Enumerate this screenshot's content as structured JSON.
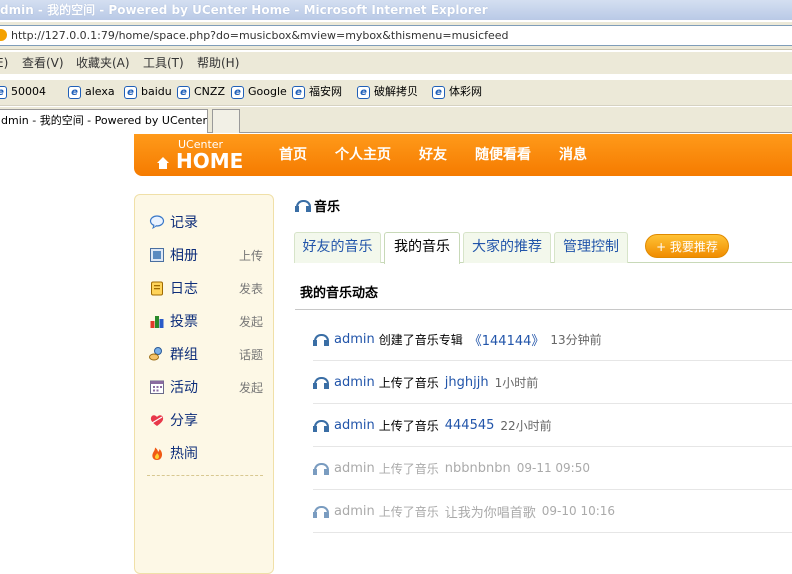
{
  "window": {
    "title": "dmin - 我的空间 - Powered by UCenter Home - Microsoft Internet Explorer"
  },
  "address": {
    "url": "http://127.0.0.1:79/home/space.php?do=musicbox&mview=mybox&thismenu=musicfeed"
  },
  "menu": {
    "items": [
      "E)",
      "查看(V)",
      "收藏夹(A)",
      "工具(T)",
      "帮助(H)"
    ]
  },
  "links": {
    "items": [
      "50004",
      "alexa",
      "baidu",
      "CNZZ",
      "Google",
      "福安网",
      "破解拷贝",
      "体彩网"
    ]
  },
  "tab": {
    "title": "dmin - 我的空间 - Powered by UCenter ..."
  },
  "header": {
    "brand_small": "UCenter",
    "brand_big": "HOME",
    "nav": [
      "首页",
      "个人主页",
      "好友",
      "随便看看",
      "消息"
    ]
  },
  "sidebar": {
    "items": [
      {
        "label": "记录",
        "action": "",
        "icon": "speech-bubble-icon"
      },
      {
        "label": "相册",
        "action": "上传",
        "icon": "photo-icon"
      },
      {
        "label": "日志",
        "action": "发表",
        "icon": "notepad-icon"
      },
      {
        "label": "投票",
        "action": "发起",
        "icon": "bar-chart-icon"
      },
      {
        "label": "群组",
        "action": "话题",
        "icon": "group-icon"
      },
      {
        "label": "活动",
        "action": "发起",
        "icon": "calendar-icon"
      },
      {
        "label": "分享",
        "action": "",
        "icon": "heart-icon"
      },
      {
        "label": "热闹",
        "action": "",
        "icon": "fire-icon"
      }
    ]
  },
  "main": {
    "section_title": "音乐",
    "tabs": [
      "好友的音乐",
      "我的音乐",
      "大家的推荐",
      "管理控制"
    ],
    "recommend_button": "+ 我要推荐",
    "feed_heading": "我的音乐动态",
    "feed": [
      {
        "user": "admin",
        "action": "创建了音乐专辑",
        "target": "《144144》",
        "time": "13分钟前",
        "faded": false
      },
      {
        "user": "admin",
        "action": "上传了音乐",
        "target": "jhghjjh",
        "time": "1小时前",
        "faded": false
      },
      {
        "user": "admin",
        "action": "上传了音乐",
        "target": "444545",
        "time": "22小时前",
        "faded": false
      },
      {
        "user": "admin",
        "action": "上传了音乐",
        "target": "nbbnbnbn",
        "time": "09-11 09:50",
        "faded": true
      },
      {
        "user": "admin",
        "action": "上传了音乐",
        "target": "让我为你唱首歌",
        "time": "09-10 10:16",
        "faded": true
      }
    ]
  },
  "colors": {
    "header_orange": "#f57b00",
    "link_blue": "#2255aa",
    "sidebar_bg": "#fdf8e6"
  }
}
